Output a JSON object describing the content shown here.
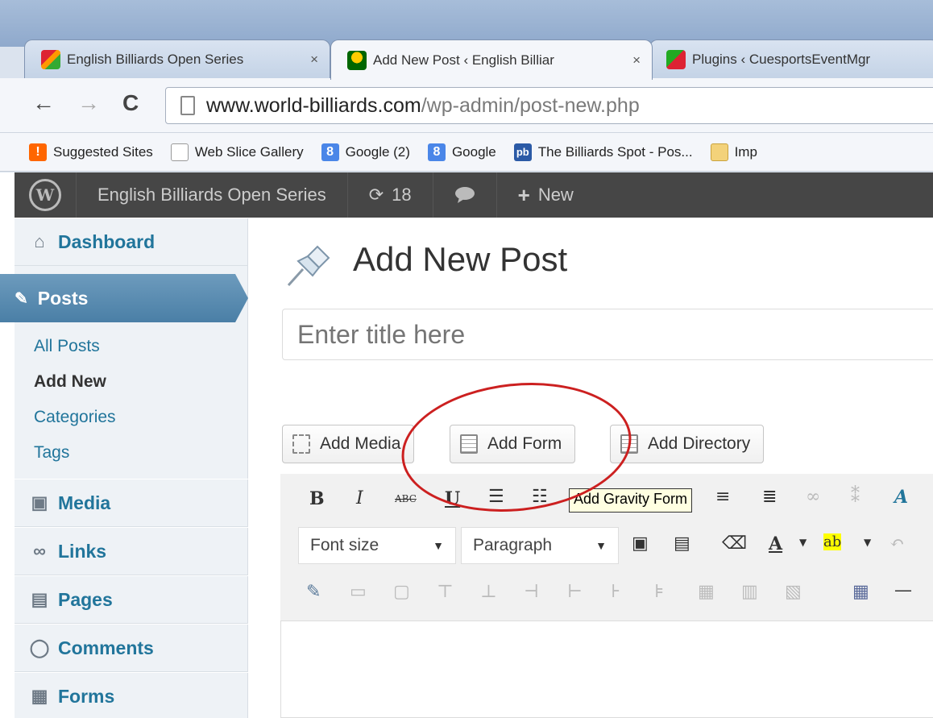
{
  "browser": {
    "tabs": [
      {
        "title": "English Billiards Open Series",
        "close": "×"
      },
      {
        "title": "Add New Post ‹ English Billiar",
        "close": "×"
      },
      {
        "title": "Plugins ‹ CuesportsEventMgr",
        "close": ""
      }
    ],
    "url_host": "www.world-billiards.com",
    "url_path": "/wp-admin/post-new.php",
    "bookmarks": [
      "Suggested Sites",
      "Web Slice Gallery",
      "Google (2)",
      "Google",
      "The Billiards Spot - Pos...",
      "Imp"
    ]
  },
  "adminbar": {
    "site_name": "English Billiards Open Series",
    "updates_count": "18",
    "new_label": "New"
  },
  "sidebar": {
    "dashboard": "Dashboard",
    "posts": "Posts",
    "submenu": [
      "All Posts",
      "Add New",
      "Categories",
      "Tags"
    ],
    "media": "Media",
    "links": "Links",
    "pages": "Pages",
    "comments": "Comments",
    "forms": "Forms"
  },
  "content": {
    "page_title": "Add New Post",
    "title_placeholder": "Enter title here",
    "buttons": {
      "add_media": "Add Media",
      "add_form": "Add Form",
      "add_directory": "Add Directory"
    },
    "toolbar": {
      "font_size": "Font size",
      "paragraph": "Paragraph",
      "tooltip": "Add Gravity Form"
    }
  },
  "colors": {
    "admin_link": "#21759b",
    "annotation_circle": "#cc2020"
  }
}
